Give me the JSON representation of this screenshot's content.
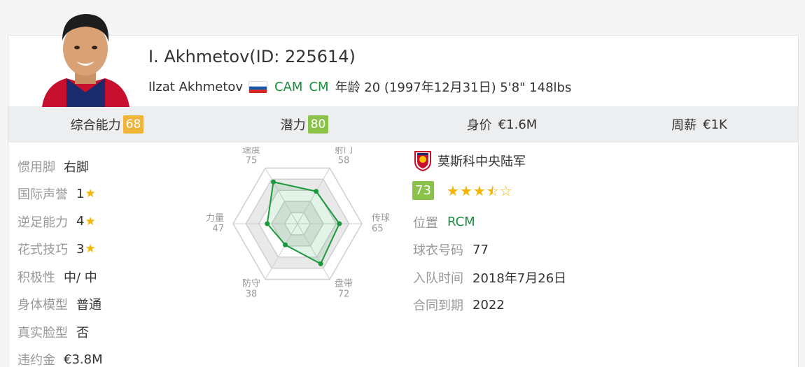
{
  "player": {
    "title": "I. Akhmetov(ID: 225614)",
    "full_name": "Ilzat Akhmetov",
    "positions": [
      "CAM",
      "CM"
    ],
    "age_text": "年龄 20 (1997年12月31日) 5'8\" 148lbs",
    "flag_icon": "russia-flag-icon"
  },
  "stats": {
    "overall_label": "综合能力",
    "overall": "68",
    "potential_label": "潜力",
    "potential": "80",
    "value_label": "身价",
    "value": "€1.6M",
    "wage_label": "周薪",
    "wage": "€1K"
  },
  "attributes": [
    {
      "label": "惯用脚",
      "value": "右脚",
      "star": false
    },
    {
      "label": "国际声誉",
      "value": "1",
      "star": true
    },
    {
      "label": "逆足能力",
      "value": "4",
      "star": true
    },
    {
      "label": "花式技巧",
      "value": "3",
      "star": true
    },
    {
      "label": "积极性",
      "value": "中/ 中",
      "star": false
    },
    {
      "label": "身体模型",
      "value": "普通",
      "star": false
    },
    {
      "label": "真实脸型",
      "value": "否",
      "star": false
    },
    {
      "label": "违约金",
      "value": "€3.8M",
      "star": false
    }
  ],
  "radar": {
    "axes": [
      {
        "label": "速度",
        "value": 75
      },
      {
        "label": "射门",
        "value": 58
      },
      {
        "label": "传球",
        "value": 65
      },
      {
        "label": "盘带",
        "value": 72
      },
      {
        "label": "防守",
        "value": 38
      },
      {
        "label": "力量",
        "value": 47
      }
    ],
    "max": 100,
    "color": "#1a9a3c"
  },
  "club": {
    "name": "莫斯科中央陆军",
    "rating": "73",
    "stars": 3.5,
    "crest_icon": "cska-crest-icon",
    "rows": [
      {
        "label": "位置",
        "value": "RCM",
        "green": true
      },
      {
        "label": "球衣号码",
        "value": "77",
        "green": false
      },
      {
        "label": "入队时间",
        "value": "2018年7月26日",
        "green": false
      },
      {
        "label": "合同到期",
        "value": "2022",
        "green": false
      }
    ]
  }
}
